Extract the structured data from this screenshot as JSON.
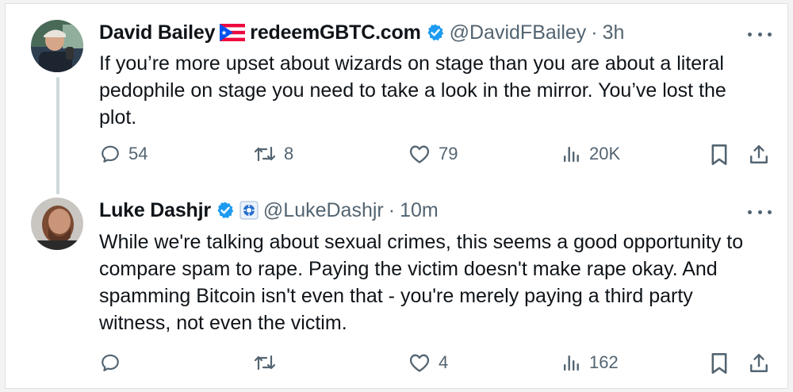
{
  "tweets": [
    {
      "name": "David Bailey",
      "flag": "puerto-rico-flag-icon",
      "name_suffix": "redeemGBTC.com",
      "verified_color": "#1d9bf0",
      "handle": "@DavidFBailey",
      "sep": "·",
      "time": "3h",
      "text": "If you’re more upset about wizards on stage than you are about a literal pedophile on stage you need to take a look in the mirror. You’ve lost the plot.",
      "replies": "54",
      "reposts": "8",
      "likes": "79",
      "views": "20K"
    },
    {
      "name": "Luke Dashjr",
      "verified_color": "#1d9bf0",
      "affiliate_icon": "affiliate-badge-icon",
      "handle": "@LukeDashjr",
      "sep": "·",
      "time": "10m",
      "text": "While we're talking about sexual crimes, this seems a good opportunity to compare spam to rape. Paying the victim doesn't make rape okay. And spamming Bitcoin isn't even that - you're merely paying a third party witness, not even the victim.",
      "replies": "",
      "reposts": "",
      "likes": "4",
      "views": "162"
    }
  ],
  "colors": {
    "text": "#0f1419",
    "muted": "#536471",
    "verified": "#1d9bf0"
  }
}
